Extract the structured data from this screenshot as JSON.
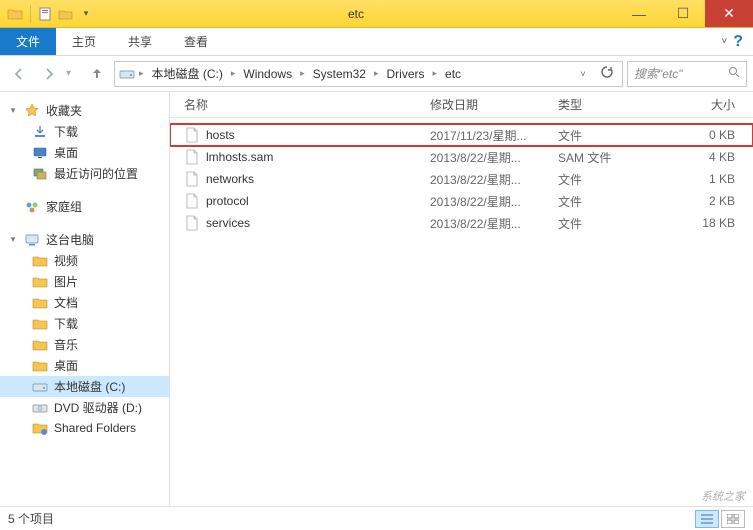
{
  "window": {
    "title": "etc"
  },
  "ribbon": {
    "tabs": [
      "文件",
      "主页",
      "共享",
      "查看"
    ]
  },
  "breadcrumb": {
    "root_label": "本地磁盘 (C:)",
    "segments": [
      "Windows",
      "System32",
      "Drivers",
      "etc"
    ]
  },
  "search": {
    "placeholder": "搜索\"etc\""
  },
  "nav": {
    "favorites": {
      "label": "收藏夹",
      "items": [
        {
          "label": "下载",
          "icon": "download"
        },
        {
          "label": "桌面",
          "icon": "desktop"
        },
        {
          "label": "最近访问的位置",
          "icon": "recent"
        }
      ]
    },
    "homegroup": {
      "label": "家庭组"
    },
    "thispc": {
      "label": "这台电脑",
      "items": [
        {
          "label": "视频",
          "icon": "folder"
        },
        {
          "label": "图片",
          "icon": "folder"
        },
        {
          "label": "文档",
          "icon": "folder"
        },
        {
          "label": "下载",
          "icon": "folder"
        },
        {
          "label": "音乐",
          "icon": "folder"
        },
        {
          "label": "桌面",
          "icon": "folder"
        },
        {
          "label": "本地磁盘 (C:)",
          "icon": "drive",
          "selected": true
        },
        {
          "label": "DVD 驱动器 (D:)",
          "icon": "dvd"
        },
        {
          "label": "Shared Folders",
          "icon": "netfolder"
        }
      ]
    }
  },
  "columns": {
    "name": "名称",
    "date": "修改日期",
    "type": "类型",
    "size": "大小"
  },
  "files": [
    {
      "name": "hosts",
      "date": "2017/11/23/星期...",
      "type": "文件",
      "size": "0 KB",
      "highlighted": true
    },
    {
      "name": "lmhosts.sam",
      "date": "2013/8/22/星期...",
      "type": "SAM 文件",
      "size": "4 KB"
    },
    {
      "name": "networks",
      "date": "2013/8/22/星期...",
      "type": "文件",
      "size": "1 KB"
    },
    {
      "name": "protocol",
      "date": "2013/8/22/星期...",
      "type": "文件",
      "size": "2 KB"
    },
    {
      "name": "services",
      "date": "2013/8/22/星期...",
      "type": "文件",
      "size": "18 KB"
    }
  ],
  "status": {
    "item_count": "5 个项目"
  },
  "watermark": "系统之家"
}
